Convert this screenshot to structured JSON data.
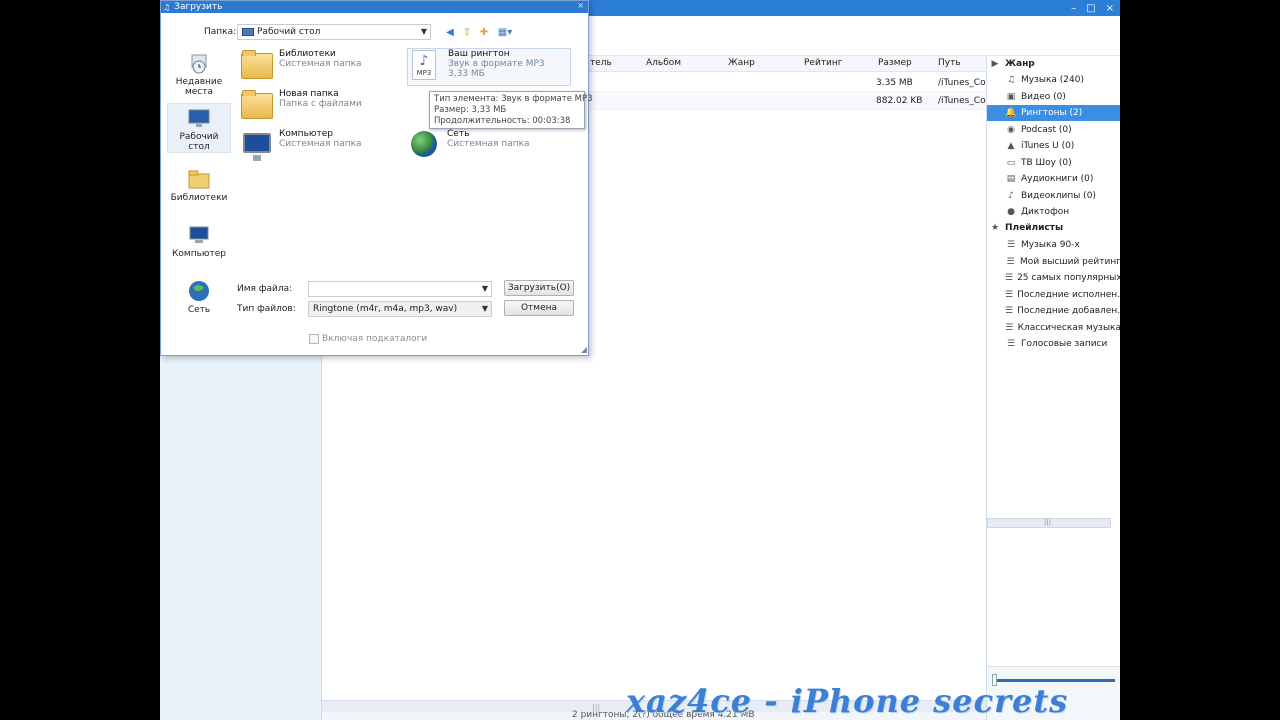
{
  "app": {
    "grid_headers": [
      "тель",
      "Альбом",
      "Жанр",
      "Рейтинг",
      "Размер",
      "Путь"
    ],
    "rows": [
      {
        "size": "3.35 MB",
        "path": "/iTunes_Co"
      },
      {
        "size": "882.02 KB",
        "path": "/iTunes_Co"
      }
    ],
    "status": "2  рингтоны, 2(?) общее время 4.21 MB"
  },
  "right_panel": {
    "genre_header": "Жанр",
    "items": [
      {
        "label": "Музыка (240)",
        "icon": "music-note-icon",
        "glyph": "♫"
      },
      {
        "label": "Видео (0)",
        "icon": "video-icon",
        "glyph": "▣"
      },
      {
        "label": "Рингтоны (2)",
        "icon": "bell-icon",
        "glyph": "🔔"
      },
      {
        "label": "Podcast (0)",
        "icon": "podcast-icon",
        "glyph": "◉"
      },
      {
        "label": "iTunes U (0)",
        "icon": "graduation-cap-icon",
        "glyph": "▲"
      },
      {
        "label": "ТВ Шоу (0)",
        "icon": "tv-icon",
        "glyph": "▭"
      },
      {
        "label": "Аудиокниги (0)",
        "icon": "audiobook-icon",
        "glyph": "▤"
      },
      {
        "label": "Видеоклипы (0)",
        "icon": "music-video-icon",
        "glyph": "♪"
      },
      {
        "label": "Диктофон",
        "icon": "microphone-icon",
        "glyph": "●"
      }
    ],
    "playlists_header": "Плейлисты",
    "playlists": [
      "Музыка 90-х",
      "Мой высший рейтинг",
      "25 самых популярных",
      "Последние исполнен...",
      "Последние добавлен...",
      "Классическая музыка",
      "Голосовые записи"
    ]
  },
  "dialog": {
    "title": "Загрузить",
    "folder_label": "Папка:",
    "folder_value": "Рабочий стол",
    "places": [
      "Недавние места",
      "Рабочий стол",
      "Библиотеки",
      "Компьютер",
      "Сеть"
    ],
    "files": [
      {
        "name": "Библиотеки",
        "sub": "Системная папка"
      },
      {
        "name": "Новая папка",
        "sub": "Папка с файлами"
      },
      {
        "name": "Компьютер",
        "sub": "Системная папка"
      },
      {
        "name": "Ваш рингтон",
        "sub": "Звук в формате MP3",
        "sub2": "3,33 МБ"
      },
      {
        "name": "Сеть",
        "sub": "Системная папка"
      }
    ],
    "tooltip": {
      "line1": "Тип элемента: Звук в формате MP3",
      "line2": "Размер: 3,33 МБ",
      "line3": "Продолжительность: 00:03:38"
    },
    "filename_label": "Имя файла:",
    "filename_value": "",
    "filetype_label": "Тип файлов:",
    "filetype_value": "Ringtone (m4r, m4a, mp3, wav)",
    "open_button": "Загрузить(O)",
    "cancel_button": "Отмена",
    "subfolders_label": "Включая подкаталоги"
  },
  "watermark": "xaz4ce - iPhone secrets"
}
